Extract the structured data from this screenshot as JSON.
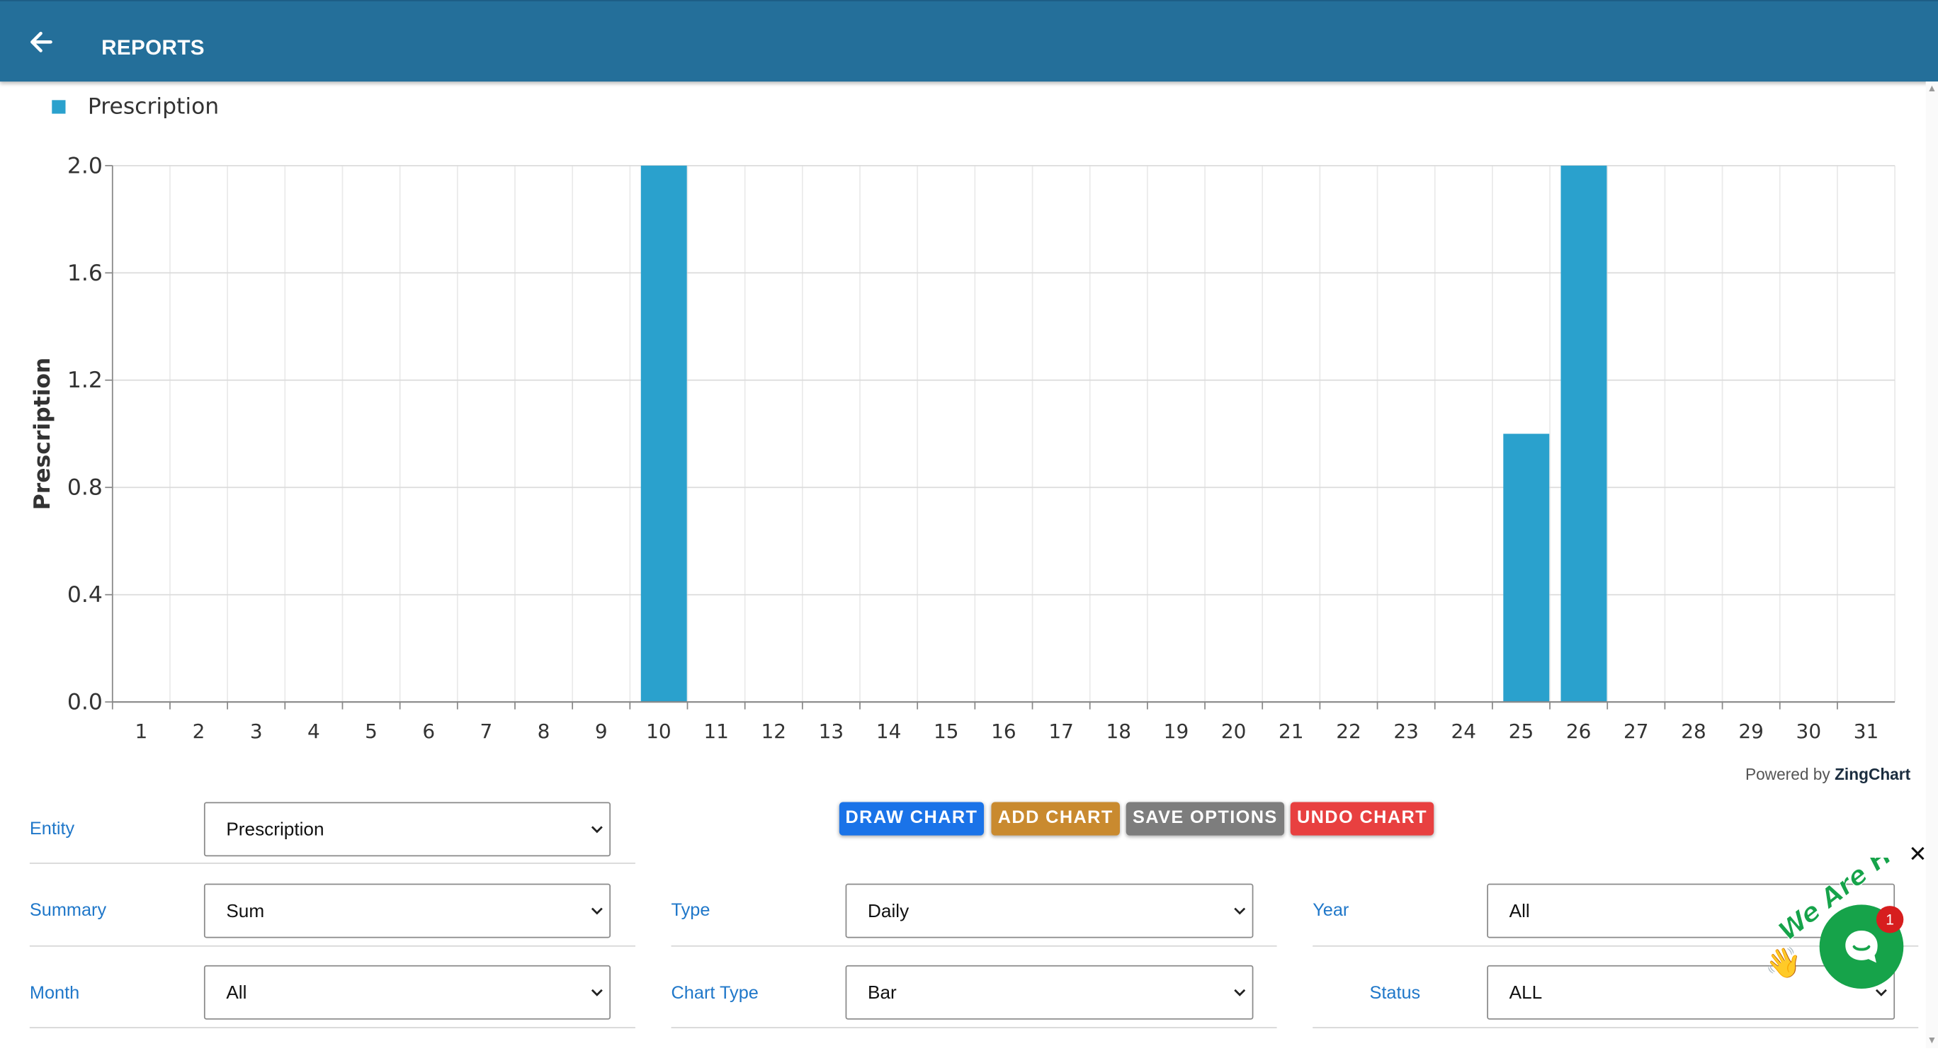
{
  "header": {
    "title": "REPORTS",
    "background": "#246f9a"
  },
  "chart_data": {
    "type": "bar",
    "legend": [
      "Prescription"
    ],
    "legend_position": "top-left",
    "ylabel": "Prescription",
    "ylim": [
      0,
      2.0
    ],
    "yticks": [
      "0.0",
      "0.4",
      "0.8",
      "1.2",
      "1.6",
      "2.0"
    ],
    "grid": true,
    "color": "#2aa1cd",
    "categories": [
      "1",
      "2",
      "3",
      "4",
      "5",
      "6",
      "7",
      "8",
      "9",
      "10",
      "11",
      "12",
      "13",
      "14",
      "15",
      "16",
      "17",
      "18",
      "19",
      "20",
      "21",
      "22",
      "23",
      "24",
      "25",
      "26",
      "27",
      "28",
      "29",
      "30",
      "31"
    ],
    "series": [
      {
        "name": "Prescription",
        "values": [
          0,
          0,
          0,
          0,
          0,
          0,
          0,
          0,
          0,
          2,
          0,
          0,
          0,
          0,
          0,
          0,
          0,
          0,
          0,
          0,
          0,
          0,
          0,
          0,
          1,
          2,
          0,
          0,
          0,
          0,
          0
        ]
      }
    ]
  },
  "powered_by": {
    "prefix": "Powered by",
    "brand": "ZingChart"
  },
  "buttons": {
    "draw": "DRAW CHART",
    "add": "ADD CHART",
    "save": "SAVE OPTIONS",
    "undo": "UNDO CHART",
    "colors": {
      "draw": "#1a73e8",
      "add": "#c98a2f",
      "save": "#7d7d7d",
      "undo": "#e84040"
    }
  },
  "filters": {
    "entity": {
      "label": "Entity",
      "value": "Prescription"
    },
    "summary": {
      "label": "Summary",
      "value": "Sum"
    },
    "month": {
      "label": "Month",
      "value": "All"
    },
    "type": {
      "label": "Type",
      "value": "Daily"
    },
    "chart_type": {
      "label": "Chart Type",
      "value": "Bar"
    },
    "year": {
      "label": "Year",
      "value": "All"
    },
    "status": {
      "label": "Status",
      "value": "ALL"
    }
  },
  "chat_widget": {
    "text": "We Are Here!",
    "badge": "1",
    "close": "✕",
    "color": "#16a34a"
  }
}
